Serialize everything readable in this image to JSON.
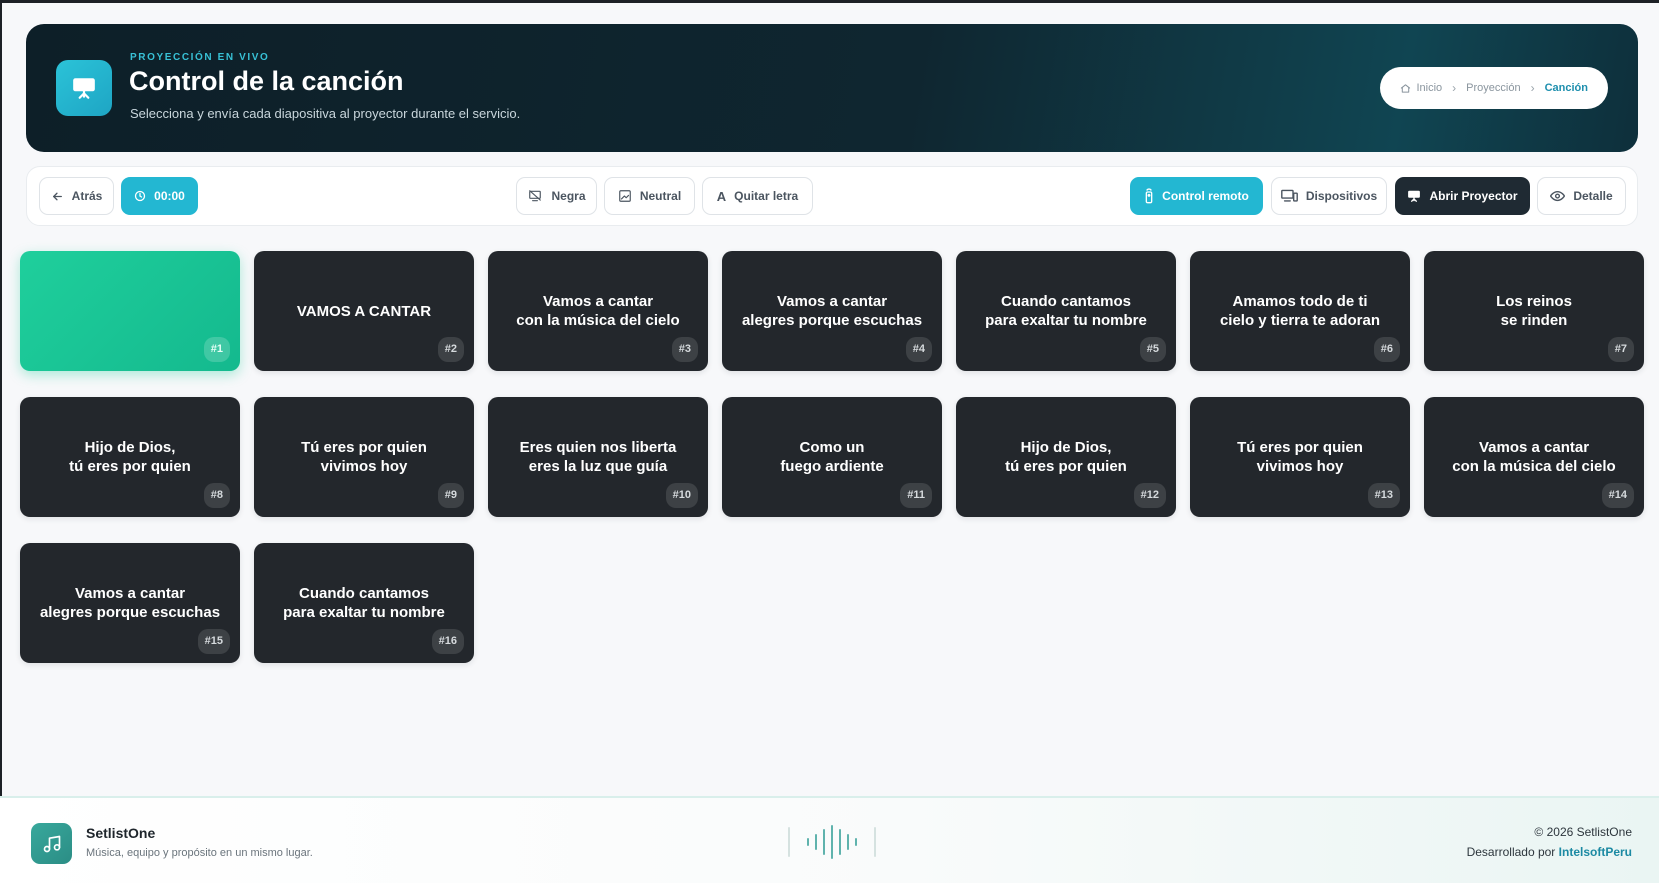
{
  "header": {
    "eyebrow": "PROYECCIÓN EN VIVO",
    "title": "Control de la canción",
    "subtitle": "Selecciona y envía cada diapositiva al proyector durante el servicio.",
    "icon": "projector-icon",
    "breadcrumb": [
      "Inicio",
      "Proyección",
      "Canción"
    ]
  },
  "toolbar": {
    "back": "Atrás",
    "timer": "00:00",
    "black": "Negra",
    "neutral": "Neutral",
    "clear_lyrics": "Quitar letra",
    "remote": "Control remoto",
    "devices": "Dispositivos",
    "open_projector": "Abrir Proyector",
    "detail": "Detalle"
  },
  "colors": {
    "accent": "#23b7d2",
    "active_slide": "#1fcf9c",
    "slide_bg": "#23272c",
    "header_bg": "#0f2630"
  },
  "slides": [
    {
      "num": "#1",
      "text": "",
      "active": true
    },
    {
      "num": "#2",
      "text": "VAMOS A CANTAR"
    },
    {
      "num": "#3",
      "text": "Vamos a cantar\ncon la música del cielo"
    },
    {
      "num": "#4",
      "text": "Vamos a cantar\nalegres porque escuchas"
    },
    {
      "num": "#5",
      "text": "Cuando cantamos\npara exaltar tu nombre"
    },
    {
      "num": "#6",
      "text": "Amamos todo de ti\ncielo y tierra te adoran"
    },
    {
      "num": "#7",
      "text": "Los reinos\nse rinden"
    },
    {
      "num": "#8",
      "text": "Hijo de Dios,\ntú eres por quien"
    },
    {
      "num": "#9",
      "text": "Tú eres por quien\nvivimos hoy"
    },
    {
      "num": "#10",
      "text": "Eres quien nos liberta\neres la luz que guía"
    },
    {
      "num": "#11",
      "text": "Como un\nfuego ardiente"
    },
    {
      "num": "#12",
      "text": "Hijo de Dios,\ntú eres por quien"
    },
    {
      "num": "#13",
      "text": "Tú eres por quien\nvivimos hoy"
    },
    {
      "num": "#14",
      "text": "Vamos a cantar\ncon la música del cielo"
    },
    {
      "num": "#15",
      "text": "Vamos a cantar\nalegres porque escuchas"
    },
    {
      "num": "#16",
      "text": "Cuando cantamos\npara exaltar tu nombre"
    }
  ],
  "footer": {
    "brand": "SetlistOne",
    "tagline": "Música, equipo y propósito en un mismo lugar.",
    "copyright": "© 2026 SetlistOne",
    "credit_prefix": "Desarrollado por",
    "credit_name": "IntelsoftPeru"
  }
}
